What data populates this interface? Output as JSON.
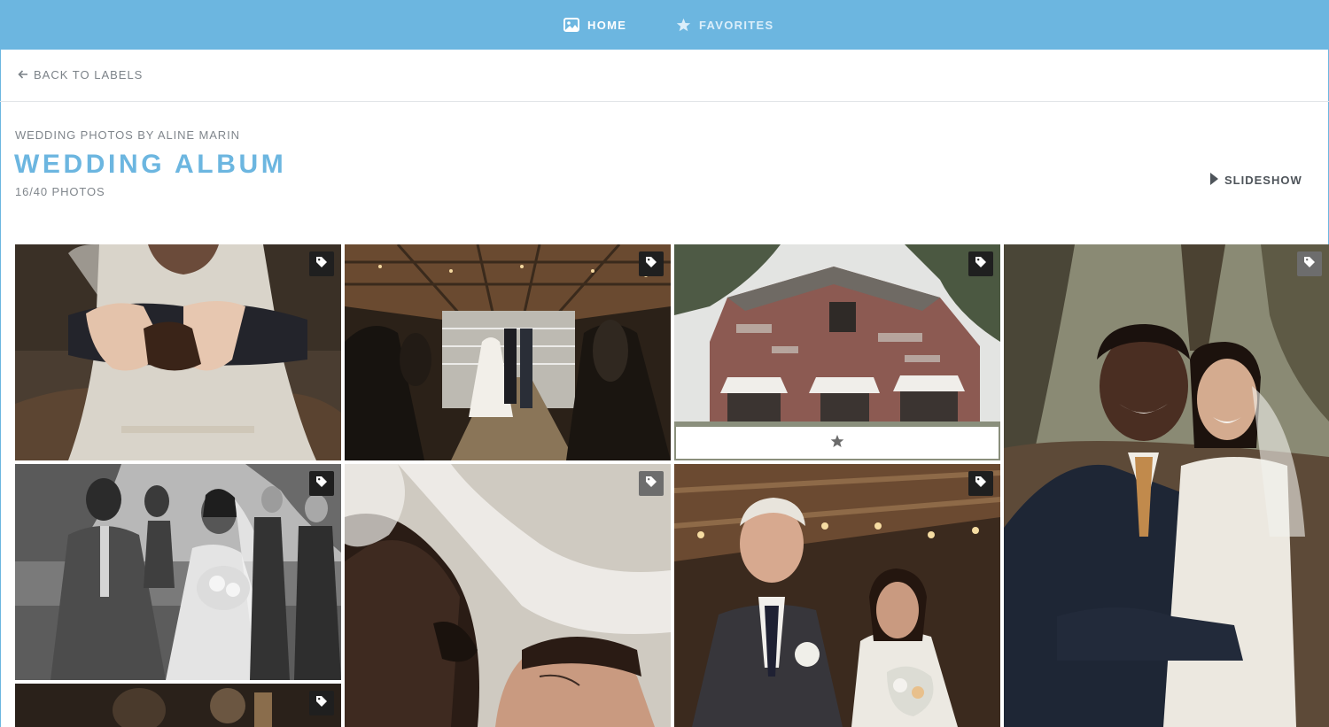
{
  "nav": {
    "home_label": "HOME",
    "favorites_label": "FAVORITES",
    "home_icon": "image-icon",
    "favorites_icon": "star-icon"
  },
  "back": {
    "label": "BACK TO LABELS",
    "icon": "arrow-left-icon"
  },
  "header": {
    "subtitle": "WEDDING PHOTOS BY ALINE MARIN",
    "title": "WEDDING ALBUM",
    "count": "16/40 PHOTOS",
    "slideshow_label": "SLIDESHOW",
    "slideshow_icon": "play-icon"
  },
  "colors": {
    "accent": "#6cb6e0",
    "text_muted": "#80868c",
    "text_dark": "#4e545a"
  },
  "photos": [
    {
      "subject": "bride-hands-with-rings",
      "tag_icon": "tag-icon"
    },
    {
      "subject": "barn-ceremony-interior",
      "tag_icon": "tag-icon"
    },
    {
      "subject": "old-red-barn-exterior",
      "tag_icon": "tag-icon",
      "favorite_icon": "star-icon"
    },
    {
      "subject": "bride-and-groom-portrait",
      "tag_icon": "tag-icon"
    },
    {
      "subject": "couple-walking-with-bridesmaids",
      "tag_icon": "tag-icon"
    },
    {
      "subject": "couple-under-veil",
      "tag_icon": "tag-icon"
    },
    {
      "subject": "father-walking-bride",
      "tag_icon": "tag-icon"
    },
    {
      "subject": "bar-detail",
      "tag_icon": "tag-icon"
    }
  ]
}
